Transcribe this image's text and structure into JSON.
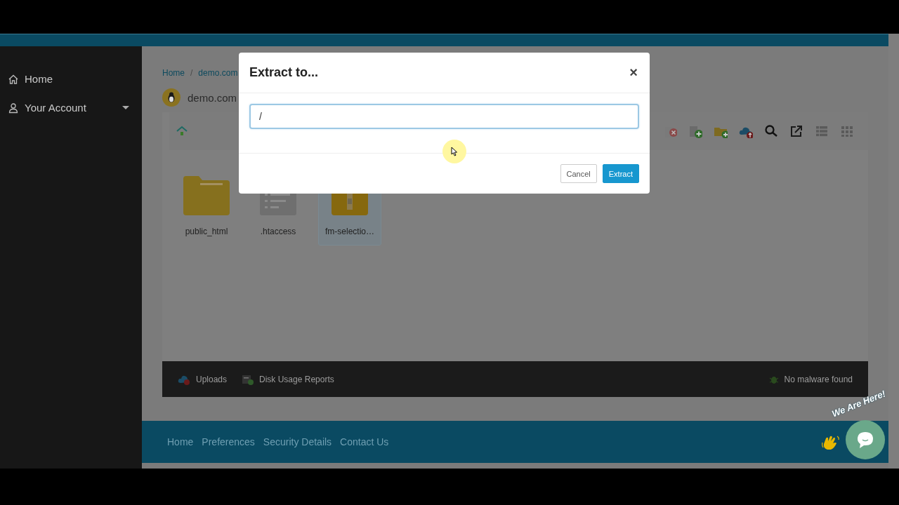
{
  "sidebar": {
    "items": [
      {
        "label": "Home",
        "kind": "home"
      },
      {
        "label": "Your Account",
        "kind": "account"
      }
    ]
  },
  "breadcrumbs": [
    "Home",
    "demo.com"
  ],
  "breadcrumb_separator": "/",
  "site": {
    "name": "demo.com"
  },
  "files": [
    {
      "name": "public_html",
      "kind": "folder",
      "selected": false
    },
    {
      "name": ".htaccess",
      "kind": "document",
      "selected": false
    },
    {
      "name": "fm-selectio…",
      "kind": "archive",
      "selected": true
    }
  ],
  "status_bar": {
    "left": [
      {
        "label": "Uploads",
        "kind": "upload"
      },
      {
        "label": "Disk Usage Reports",
        "kind": "disk"
      }
    ],
    "right": {
      "label": "No malware found"
    }
  },
  "footer_links": [
    "Home",
    "Preferences",
    "Security Details",
    "Contact Us"
  ],
  "chat_widget": {
    "label": "We Are Here!"
  },
  "dialog": {
    "title": "Extract to...",
    "close": "×",
    "path": "/",
    "buttons": [
      {
        "label": "Cancel",
        "kind": "secondary"
      },
      {
        "label": "Extract",
        "kind": "primary"
      }
    ]
  }
}
